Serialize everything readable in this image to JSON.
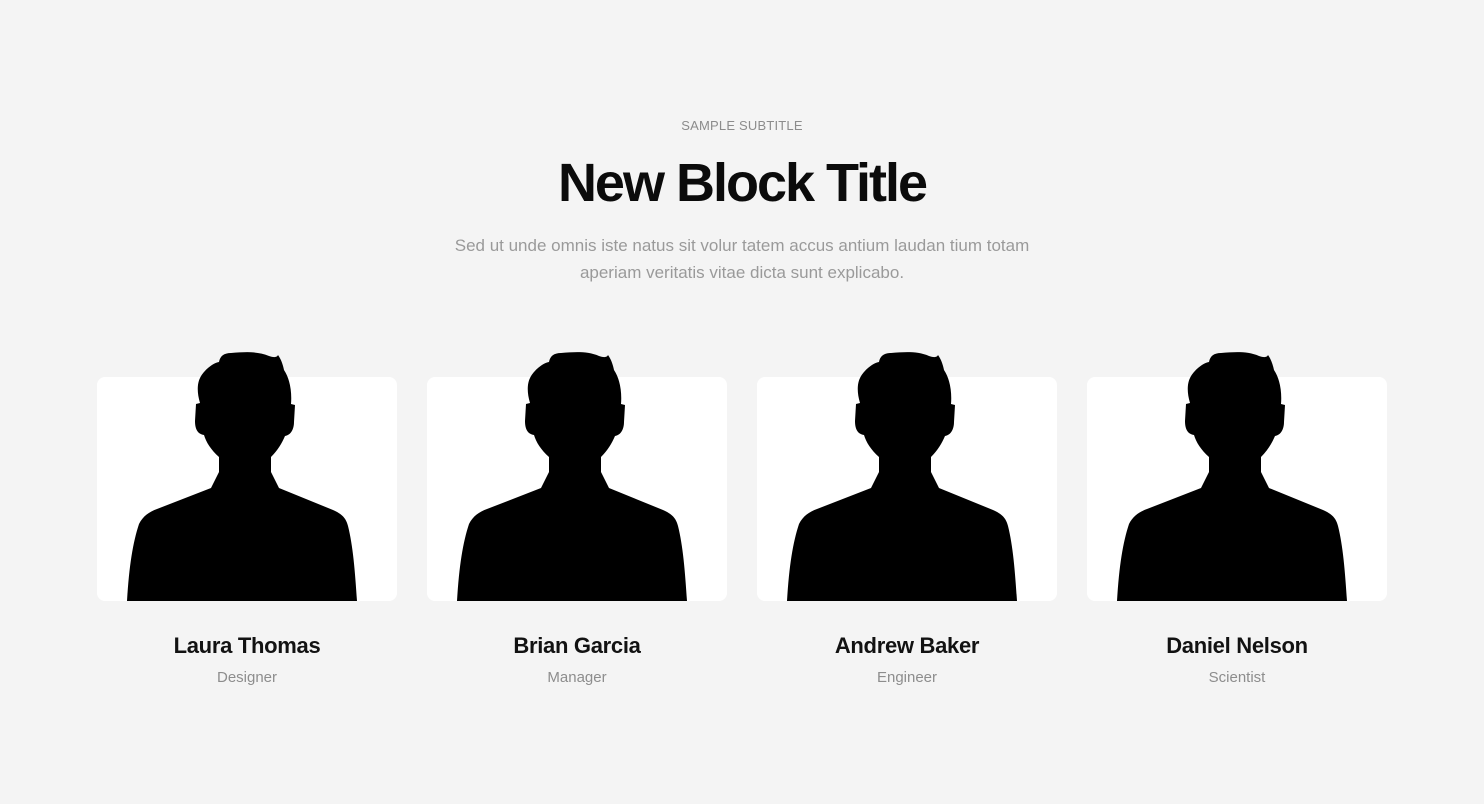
{
  "section": {
    "subtitle": "SAMPLE SUBTITLE",
    "title": "New Block Title",
    "description": "Sed ut unde omnis iste natus sit volur tatem accus antium laudan tium totam aperiam veritatis vitae dicta sunt explicabo."
  },
  "team": [
    {
      "name": "Laura Thomas",
      "role": "Designer",
      "avatar_icon": "person-silhouette-icon"
    },
    {
      "name": "Brian Garcia",
      "role": "Manager",
      "avatar_icon": "person-silhouette-icon"
    },
    {
      "name": "Andrew Baker",
      "role": "Engineer",
      "avatar_icon": "person-silhouette-icon"
    },
    {
      "name": "Daniel Nelson",
      "role": "Scientist",
      "avatar_icon": "person-silhouette-icon"
    }
  ],
  "colors": {
    "background": "#f4f4f4",
    "card": "#ffffff",
    "title": "#0b0b0b",
    "muted_text": "#9a9a9a",
    "silhouette": "#000000"
  }
}
